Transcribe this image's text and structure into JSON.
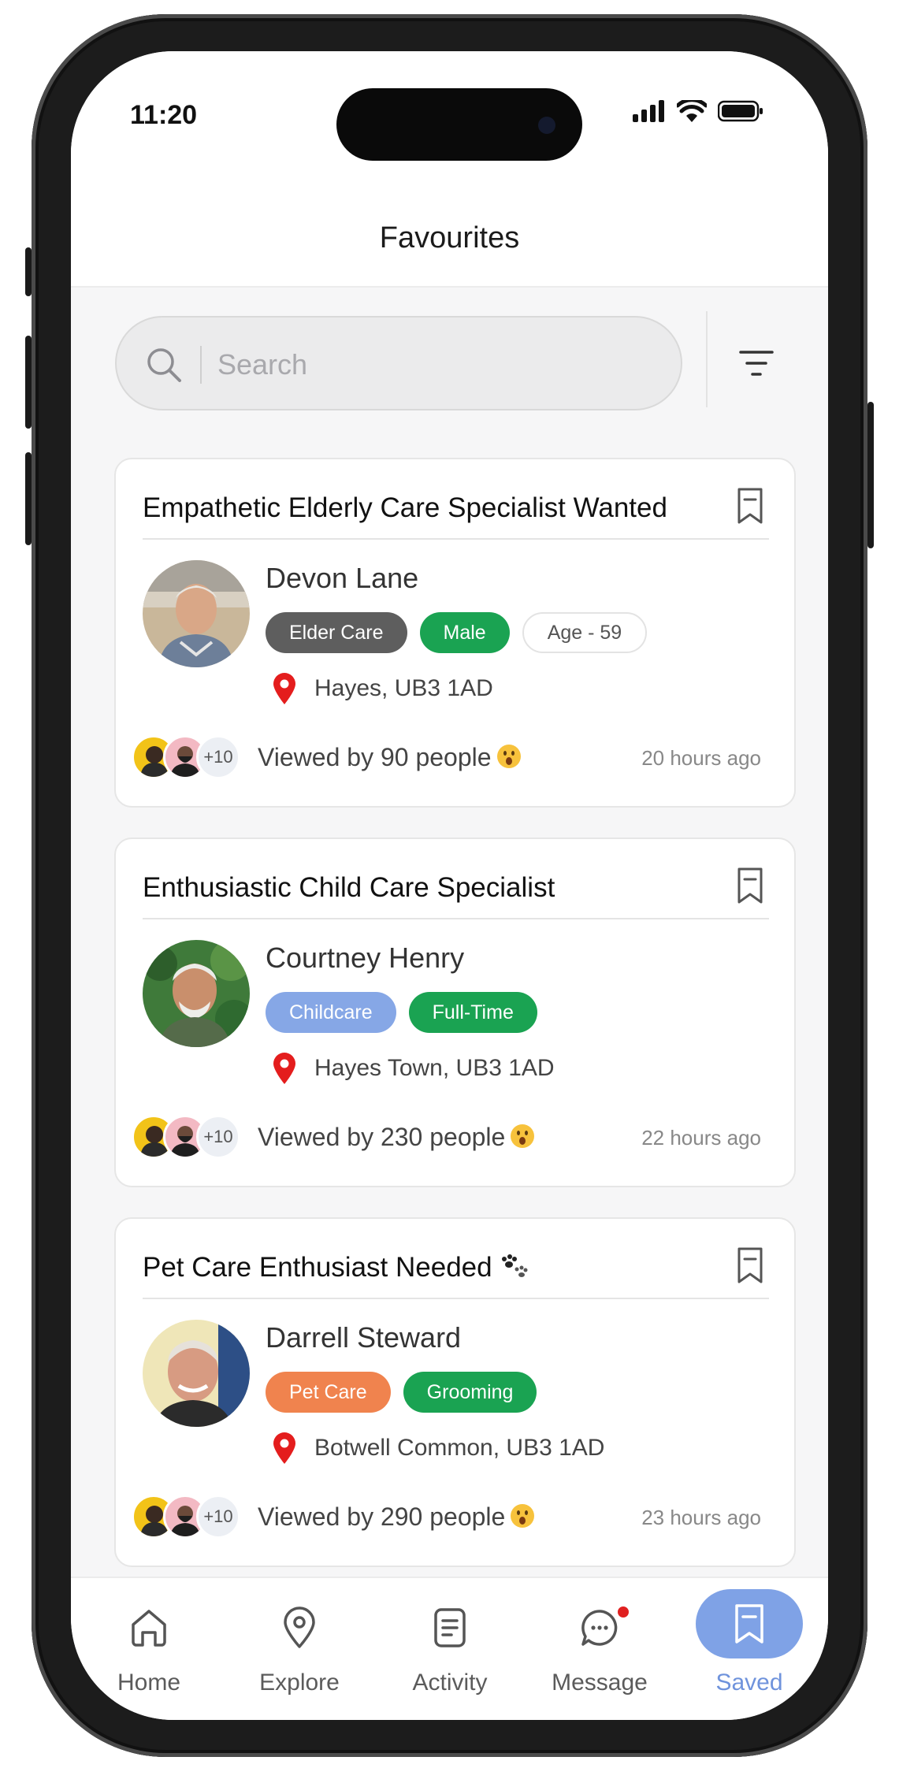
{
  "status_bar": {
    "time": "11:20"
  },
  "header": {
    "title": "Favourites"
  },
  "search": {
    "placeholder": "Search"
  },
  "colors": {
    "grey_tag": "#5e5e5e",
    "green_tag": "#1aa352",
    "blue_tag": "#86a7e6",
    "orange_tag": "#f0834e",
    "accent": "#7fa2e6",
    "pin": "#e41d1d"
  },
  "cards": [
    {
      "title": "Empathetic Elderly Care Specialist Wanted",
      "name": "Devon Lane",
      "tags": [
        {
          "label": "Elder Care",
          "style": "grey"
        },
        {
          "label": "Male",
          "style": "green"
        },
        {
          "label": "Age - 59",
          "style": "outline"
        }
      ],
      "location": "Hayes, UB3 1AD",
      "viewers_extra": "+10",
      "viewed": "Viewed by 90 people",
      "time_ago": "20 hours ago"
    },
    {
      "title": "Enthusiastic Child Care Specialist",
      "name": "Courtney Henry",
      "tags": [
        {
          "label": "Childcare",
          "style": "blue"
        },
        {
          "label": "Full-Time",
          "style": "green"
        }
      ],
      "location": "Hayes Town, UB3 1AD",
      "viewers_extra": "+10",
      "viewed": "Viewed by 230 people",
      "time_ago": "22 hours ago"
    },
    {
      "title": "Pet Care Enthusiast Needed",
      "name": "Darrell Steward",
      "tags": [
        {
          "label": "Pet Care",
          "style": "orange"
        },
        {
          "label": "Grooming",
          "style": "green"
        }
      ],
      "location": "Botwell Common, UB3 1AD",
      "viewers_extra": "+10",
      "viewed": "Viewed by 290 people",
      "time_ago": "23 hours ago"
    }
  ],
  "nav": {
    "items": [
      {
        "label": "Home",
        "icon": "home-icon"
      },
      {
        "label": "Explore",
        "icon": "map-pin-icon"
      },
      {
        "label": "Activity",
        "icon": "document-icon"
      },
      {
        "label": "Message",
        "icon": "chat-icon"
      },
      {
        "label": "Saved",
        "icon": "bookmark-icon",
        "active": true
      }
    ]
  }
}
